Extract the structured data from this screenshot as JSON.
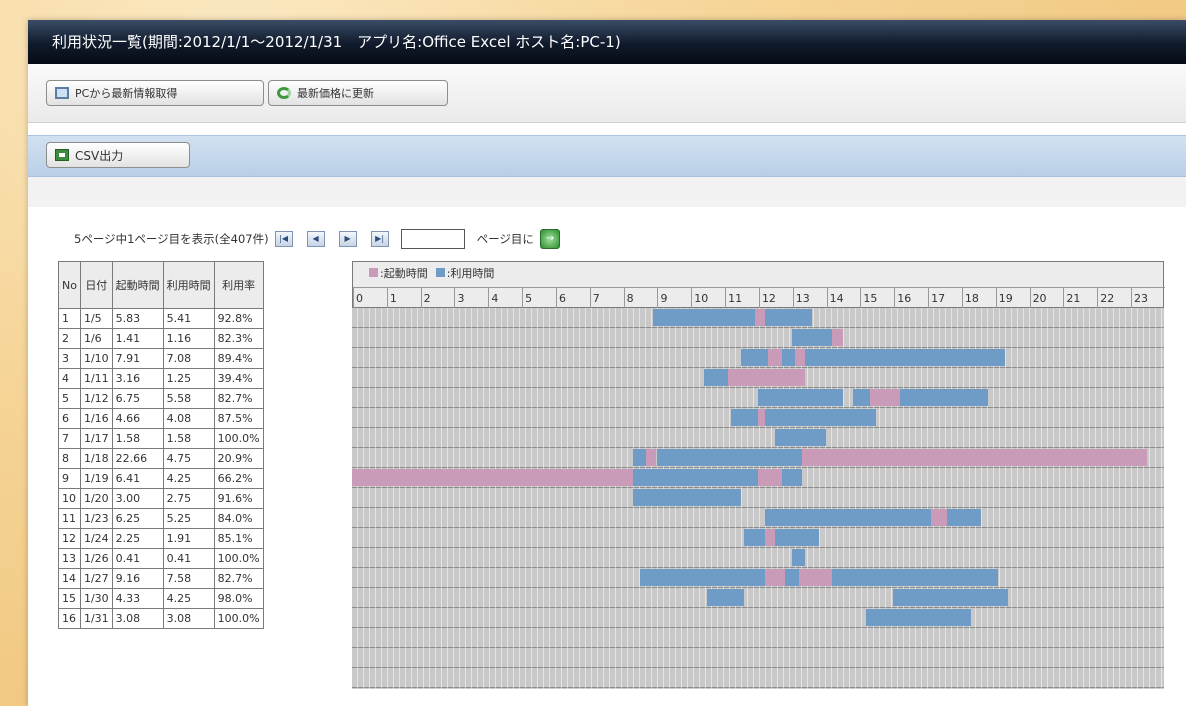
{
  "window": {
    "title": "利用状況一覧(期間:2012/1/1～2012/1/31　アプリ名:Office Excel ホスト名:PC-1)"
  },
  "toolbar": {
    "fetch_label": "PCから最新情報取得",
    "update_label": "最新価格に更新"
  },
  "csv": {
    "label": "CSV出力"
  },
  "pager": {
    "summary": "5ページ中1ページ目を表示(全407件)",
    "page_suffix": "ページ目に",
    "first_icon": "first-page-icon",
    "prev_icon": "prev-page-icon",
    "next_icon": "next-page-icon",
    "last_icon": "last-page-icon"
  },
  "table": {
    "headers": {
      "no": "No",
      "date": "日付",
      "start": "起動時間",
      "use": "利用時間",
      "rate": "利用率"
    },
    "rows": [
      {
        "no": "1",
        "date": "1/5",
        "start": "5.83",
        "use": "5.41",
        "rate": "92.8%"
      },
      {
        "no": "2",
        "date": "1/6",
        "start": "1.41",
        "use": "1.16",
        "rate": "82.3%"
      },
      {
        "no": "3",
        "date": "1/10",
        "start": "7.91",
        "use": "7.08",
        "rate": "89.4%"
      },
      {
        "no": "4",
        "date": "1/11",
        "start": "3.16",
        "use": "1.25",
        "rate": "39.4%"
      },
      {
        "no": "5",
        "date": "1/12",
        "start": "6.75",
        "use": "5.58",
        "rate": "82.7%"
      },
      {
        "no": "6",
        "date": "1/16",
        "start": "4.66",
        "use": "4.08",
        "rate": "87.5%"
      },
      {
        "no": "7",
        "date": "1/17",
        "start": "1.58",
        "use": "1.58",
        "rate": "100.0%"
      },
      {
        "no": "8",
        "date": "1/18",
        "start": "22.66",
        "use": "4.75",
        "rate": "20.9%"
      },
      {
        "no": "9",
        "date": "1/19",
        "start": "6.41",
        "use": "4.25",
        "rate": "66.2%"
      },
      {
        "no": "10",
        "date": "1/20",
        "start": "3.00",
        "use": "2.75",
        "rate": "91.6%"
      },
      {
        "no": "11",
        "date": "1/23",
        "start": "6.25",
        "use": "5.25",
        "rate": "84.0%"
      },
      {
        "no": "12",
        "date": "1/24",
        "start": "2.25",
        "use": "1.91",
        "rate": "85.1%"
      },
      {
        "no": "13",
        "date": "1/26",
        "start": "0.41",
        "use": "0.41",
        "rate": "100.0%"
      },
      {
        "no": "14",
        "date": "1/27",
        "start": "9.16",
        "use": "7.58",
        "rate": "82.7%"
      },
      {
        "no": "15",
        "date": "1/30",
        "start": "4.33",
        "use": "4.25",
        "rate": "98.0%"
      },
      {
        "no": "16",
        "date": "1/31",
        "start": "3.08",
        "use": "3.08",
        "rate": "100.0%"
      }
    ]
  },
  "timeline": {
    "legend": {
      "start": ":起動時間",
      "use": ":利用時間"
    },
    "colors": {
      "start": "#c99bb8",
      "use": "#6f9bc7"
    },
    "hours": [
      "0",
      "1",
      "2",
      "3",
      "4",
      "5",
      "6",
      "7",
      "8",
      "9",
      "10",
      "11",
      "12",
      "13",
      "14",
      "15",
      "16",
      "17",
      "18",
      "19",
      "20",
      "21",
      "22",
      "23"
    ],
    "rows": [
      [
        [
          "u",
          8.9,
          11.9
        ],
        [
          "s",
          11.9,
          12.2
        ],
        [
          "u",
          12.2,
          13.6
        ]
      ],
      [
        [
          "u",
          13.0,
          14.2
        ],
        [
          "s",
          14.2,
          14.5
        ]
      ],
      [
        [
          "u",
          11.5,
          12.3
        ],
        [
          "s",
          12.3,
          12.7
        ],
        [
          "u",
          12.7,
          13.1
        ],
        [
          "s",
          13.1,
          13.4
        ],
        [
          "u",
          13.4,
          16.2
        ],
        [
          "u",
          16.2,
          19.3
        ]
      ],
      [
        [
          "u",
          10.4,
          11.1
        ],
        [
          "s",
          11.1,
          13.4
        ]
      ],
      [
        [
          "u",
          12.0,
          14.5
        ],
        [
          "u",
          14.8,
          15.3
        ],
        [
          "s",
          15.3,
          16.2
        ],
        [
          "u",
          16.2,
          18.8
        ]
      ],
      [
        [
          "u",
          11.2,
          12.0
        ],
        [
          "s",
          12.0,
          12.2
        ],
        [
          "u",
          12.2,
          15.5
        ]
      ],
      [
        [
          "u",
          12.5,
          14.0
        ]
      ],
      [
        [
          "u",
          8.3,
          8.7
        ],
        [
          "s",
          8.7,
          9.0
        ],
        [
          "u",
          9.0,
          13.3
        ],
        [
          "s",
          13.3,
          23.5
        ]
      ],
      [
        [
          "s",
          0.0,
          8.3
        ],
        [
          "u",
          8.3,
          12.0
        ],
        [
          "s",
          12.0,
          12.7
        ],
        [
          "u",
          12.7,
          13.3
        ]
      ],
      [
        [
          "u",
          8.3,
          11.5
        ]
      ],
      [
        [
          "u",
          12.2,
          17.1
        ],
        [
          "s",
          17.1,
          17.6
        ],
        [
          "u",
          17.6,
          18.6
        ]
      ],
      [
        [
          "u",
          11.6,
          12.2
        ],
        [
          "s",
          12.2,
          12.5
        ],
        [
          "u",
          12.5,
          13.8
        ]
      ],
      [
        [
          "u",
          13.0,
          13.4
        ]
      ],
      [
        [
          "u",
          8.5,
          12.2
        ],
        [
          "s",
          12.2,
          12.8
        ],
        [
          "u",
          12.8,
          13.2
        ],
        [
          "s",
          13.2,
          14.2
        ],
        [
          "u",
          14.2,
          19.1
        ]
      ],
      [
        [
          "u",
          10.5,
          11.6
        ],
        [
          "u",
          16.0,
          19.4
        ]
      ],
      [
        [
          "u",
          15.2,
          18.3
        ]
      ]
    ]
  }
}
